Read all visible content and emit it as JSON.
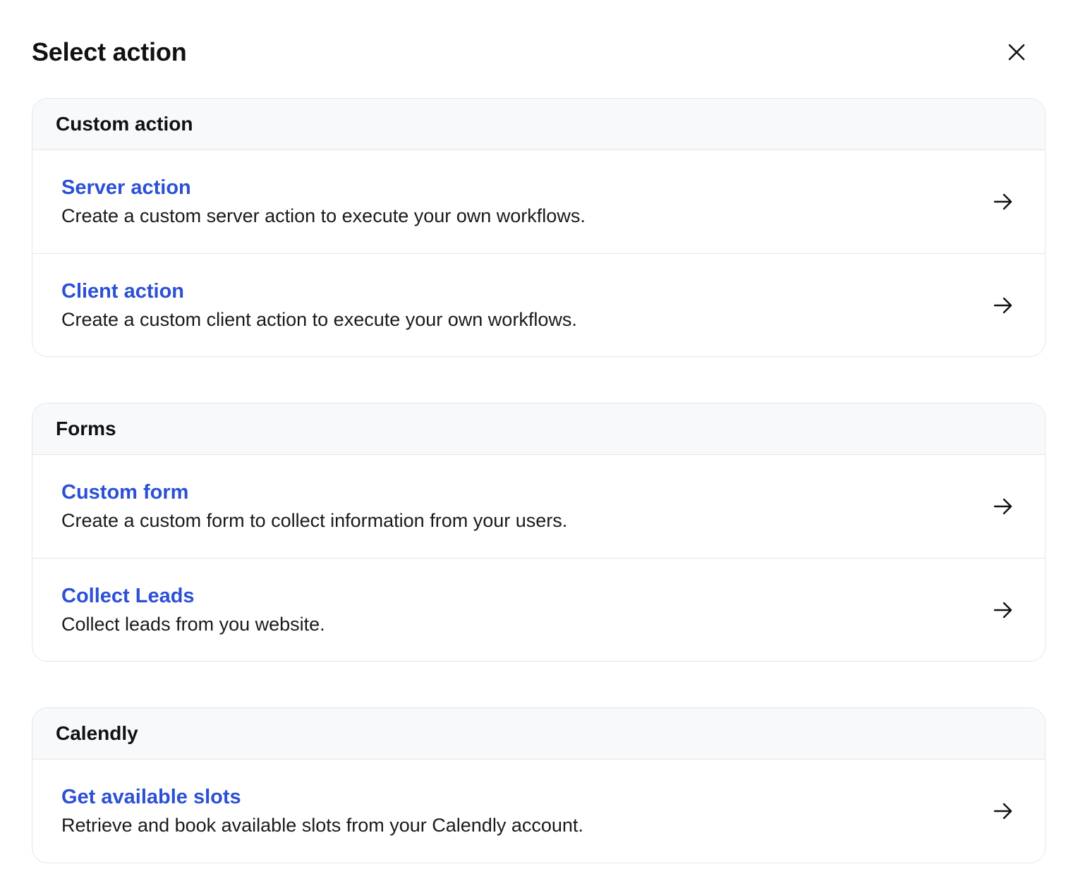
{
  "dialog": {
    "title": "Select action",
    "close_icon": "close-icon"
  },
  "sections": [
    {
      "title": "Custom action",
      "items": [
        {
          "title": "Server action",
          "description": "Create a custom server action to execute your own workflows.",
          "icon": "arrow-right-icon"
        },
        {
          "title": "Client action",
          "description": "Create a custom client action to execute your own workflows.",
          "icon": "arrow-right-icon"
        }
      ]
    },
    {
      "title": "Forms",
      "items": [
        {
          "title": "Custom form",
          "description": "Create a custom form to collect information from your users.",
          "icon": "arrow-right-icon"
        },
        {
          "title": "Collect Leads",
          "description": "Collect leads from you website.",
          "icon": "arrow-right-icon"
        }
      ]
    },
    {
      "title": "Calendly",
      "items": [
        {
          "title": "Get available slots",
          "description": "Retrieve and book available slots from your Calendly account.",
          "icon": "arrow-right-icon"
        }
      ]
    }
  ],
  "colors": {
    "link": "#2b50d6",
    "text": "#111111",
    "border": "#e3e6ea",
    "header_bg": "#f7f9fb"
  }
}
